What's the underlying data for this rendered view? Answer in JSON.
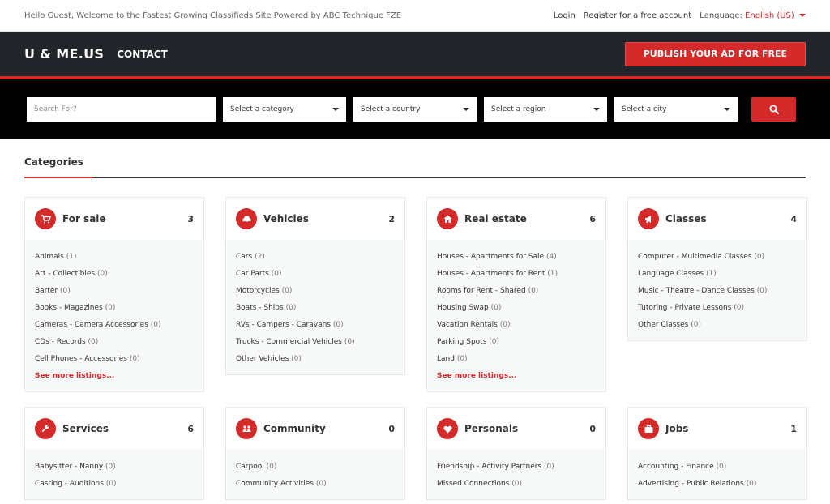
{
  "topbar": {
    "welcome": "Hello Guest, Welcome to the Fastest Growing Classifieds Site Powered by ABC Technique FZE",
    "login": "Login",
    "register": "Register for a free account",
    "language_label": "Language:",
    "language_value": "English (US)"
  },
  "header": {
    "logo": "U & ME.US",
    "contact": "CONTACT",
    "publish": "PUBLISH YOUR AD FOR FREE"
  },
  "search": {
    "placeholder": "Search For?",
    "category": "Select a category",
    "country": "Select a country",
    "region": "Select a region",
    "city": "Select a city"
  },
  "categories_title": "Categories",
  "colors": {
    "accent": "#d52a2a",
    "header_bg": "#22252a",
    "search_bg": "#000000"
  },
  "cards": [
    {
      "title": "For sale",
      "count": "3",
      "icon": "cart-icon",
      "items": [
        {
          "label": "Animals",
          "n": "(1)"
        },
        {
          "label": "Art - Collectibles",
          "n": "(0)"
        },
        {
          "label": "Barter",
          "n": "(0)"
        },
        {
          "label": "Books - Magazines",
          "n": "(0)"
        },
        {
          "label": "Cameras - Camera Accessories",
          "n": "(0)"
        },
        {
          "label": "CDs - Records",
          "n": "(0)"
        },
        {
          "label": "Cell Phones - Accessories",
          "n": "(0)"
        }
      ],
      "more": "See more listings..."
    },
    {
      "title": "Vehicles",
      "count": "2",
      "icon": "car-icon",
      "items": [
        {
          "label": "Cars",
          "n": "(2)"
        },
        {
          "label": "Car Parts",
          "n": "(0)"
        },
        {
          "label": "Motorcycles",
          "n": "(0)"
        },
        {
          "label": "Boats - Ships",
          "n": "(0)"
        },
        {
          "label": "RVs - Campers - Caravans",
          "n": "(0)"
        },
        {
          "label": "Trucks - Commercial Vehicles",
          "n": "(0)"
        },
        {
          "label": "Other Vehicles",
          "n": "(0)"
        }
      ]
    },
    {
      "title": "Real estate",
      "count": "6",
      "icon": "home-icon",
      "items": [
        {
          "label": "Houses - Apartments for Sale",
          "n": "(4)"
        },
        {
          "label": "Houses - Apartments for Rent",
          "n": "(1)"
        },
        {
          "label": "Rooms for Rent - Shared",
          "n": "(0)"
        },
        {
          "label": "Housing Swap",
          "n": "(0)"
        },
        {
          "label": "Vacation Rentals",
          "n": "(0)"
        },
        {
          "label": "Parking Spots",
          "n": "(0)"
        },
        {
          "label": "Land",
          "n": "(0)"
        }
      ],
      "more": "See more listings..."
    },
    {
      "title": "Classes",
      "count": "4",
      "icon": "megaphone-icon",
      "items": [
        {
          "label": "Computer - Multimedia Classes",
          "n": "(0)"
        },
        {
          "label": "Language Classes",
          "n": "(1)"
        },
        {
          "label": "Music - Theatre - Dance Classes",
          "n": "(0)"
        },
        {
          "label": "Tutoring - Private Lessons",
          "n": "(0)"
        },
        {
          "label": "Other Classes",
          "n": "(0)"
        }
      ]
    },
    {
      "title": "Services",
      "count": "6",
      "icon": "wrench-icon",
      "items": [
        {
          "label": "Babysitter - Nanny",
          "n": "(0)"
        },
        {
          "label": "Casting - Auditions",
          "n": "(0)"
        }
      ]
    },
    {
      "title": "Community",
      "count": "0",
      "icon": "people-icon",
      "items": [
        {
          "label": "Carpool",
          "n": "(0)"
        },
        {
          "label": "Community Activities",
          "n": "(0)"
        }
      ]
    },
    {
      "title": "Personals",
      "count": "0",
      "icon": "heart-icon",
      "items": [
        {
          "label": "Friendship - Activity Partners",
          "n": "(0)"
        },
        {
          "label": "Missed Connections",
          "n": "(0)"
        }
      ]
    },
    {
      "title": "Jobs",
      "count": "1",
      "icon": "briefcase-icon",
      "items": [
        {
          "label": "Accounting - Finance",
          "n": "(0)"
        },
        {
          "label": "Advertising - Public Relations",
          "n": "(0)"
        }
      ]
    }
  ]
}
